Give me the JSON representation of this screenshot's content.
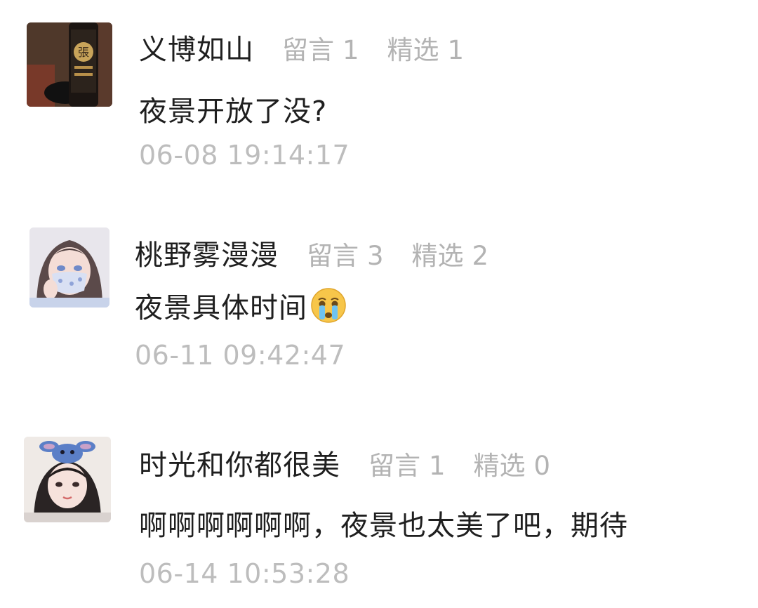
{
  "comments": [
    {
      "username": "义博如山",
      "liuyan_label": "留言",
      "liuyan_count": "1",
      "jingxuan_label": "精选",
      "jingxuan_count": "1",
      "content": "夜景开放了没?",
      "time": "06-08 19:14:17",
      "avatar_icon": "lantern-photo-avatar"
    },
    {
      "username": "桃野雾漫漫",
      "liuyan_label": "留言",
      "liuyan_count": "3",
      "jingxuan_label": "精选",
      "jingxuan_count": "2",
      "content": "夜景具体时间",
      "emoji": "crying-face-emoji",
      "time": "06-11 09:42:47",
      "avatar_icon": "masked-girl-illustration-avatar"
    },
    {
      "username": "时光和你都很美",
      "liuyan_label": "留言",
      "liuyan_count": "1",
      "jingxuan_label": "精选",
      "jingxuan_count": "0",
      "content": "啊啊啊啊啊啊，夜景也太美了吧，期待",
      "time": "06-14 10:53:28",
      "avatar_icon": "girl-with-stitch-hat-avatar"
    }
  ],
  "colors": {
    "username": "#1f1f1f",
    "muted": "#b3b3b3",
    "time": "#bdbdbd"
  }
}
